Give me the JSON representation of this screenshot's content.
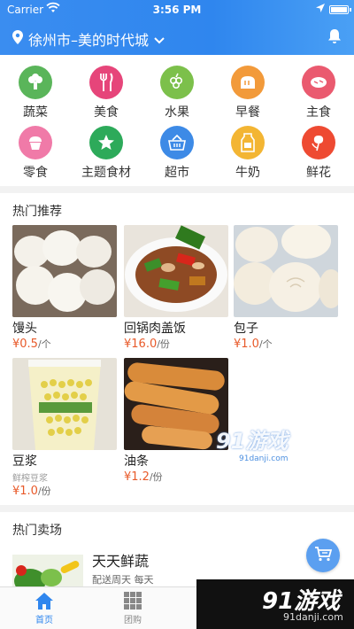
{
  "status_bar": {
    "carrier": "Carrier",
    "time": "3:56 PM"
  },
  "header": {
    "location": "徐州市–美的时代城"
  },
  "categories": [
    {
      "label": "蔬菜",
      "color": "#5ab55a",
      "icon": "broccoli-icon"
    },
    {
      "label": "美食",
      "color": "#e6457a",
      "icon": "utensils-icon"
    },
    {
      "label": "水果",
      "color": "#7cc04b",
      "icon": "grapes-icon"
    },
    {
      "label": "早餐",
      "color": "#f29a3a",
      "icon": "bread-icon"
    },
    {
      "label": "主食",
      "color": "#ea5a6f",
      "icon": "rice-icon"
    },
    {
      "label": "零食",
      "color": "#f07aa8",
      "icon": "cupcake-icon"
    },
    {
      "label": "主题食材",
      "color": "#2daa5a",
      "icon": "star-icon"
    },
    {
      "label": "超市",
      "color": "#3d8ae6",
      "icon": "basket-icon"
    },
    {
      "label": "牛奶",
      "color": "#f3b533",
      "icon": "milk-icon"
    },
    {
      "label": "鲜花",
      "color": "#ee4a32",
      "icon": "flower-icon"
    }
  ],
  "hot_recommend": {
    "title": "热门推荐",
    "items": [
      {
        "name": "馒头",
        "sub": "",
        "price": "¥0.5",
        "unit": "/个"
      },
      {
        "name": "回锅肉盖饭",
        "sub": "",
        "price": "¥16.0",
        "unit": "/份"
      },
      {
        "name": "包子",
        "sub": "",
        "price": "¥1.0",
        "unit": "/个"
      },
      {
        "name": "豆浆",
        "sub": "鲜榨豆浆",
        "price": "¥1.0",
        "unit": "/份"
      },
      {
        "name": "油条",
        "sub": "",
        "price": "¥1.2",
        "unit": "/份"
      }
    ]
  },
  "hot_market": {
    "title": "热门卖场",
    "store_name": "天天鲜蔬",
    "store_sub": "配送周天 每天"
  },
  "tabbar": {
    "tabs": [
      {
        "label": "首页"
      },
      {
        "label": "团购"
      }
    ]
  },
  "watermark": {
    "brand": "91游戏",
    "url": "91danji.com"
  }
}
